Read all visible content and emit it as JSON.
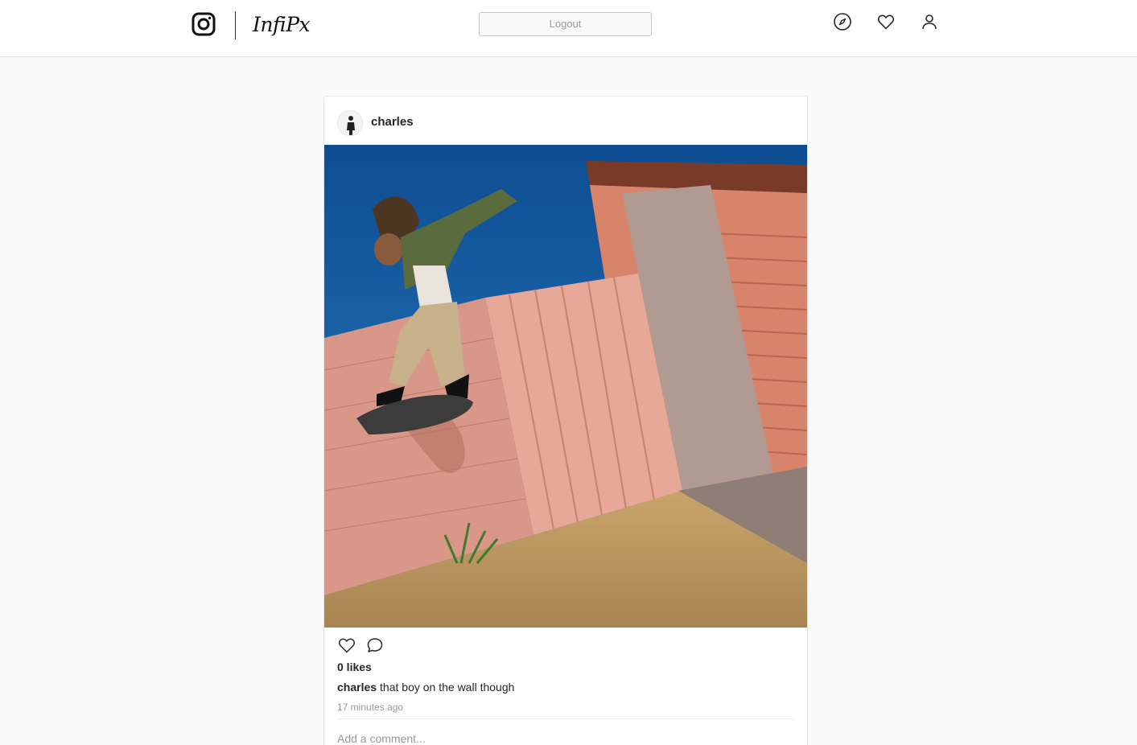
{
  "header": {
    "brand_name": "InfiPx",
    "logout_label": "Logout",
    "icons": [
      "camera-logo-icon",
      "compass-icon",
      "heart-icon",
      "profile-icon"
    ]
  },
  "post": {
    "username": "charles",
    "image_description_icon": "skateboarder-photo",
    "likes": "0 likes",
    "caption_user": "charles",
    "caption_text": "that boy on the wall though",
    "time_ago": "17 minutes ago",
    "comment_placeholder": "Add a comment..."
  },
  "colors": {
    "background": "#fafafa",
    "card": "#ffffff",
    "border": "#dbdbdb",
    "text": "#262626",
    "muted": "#999999"
  }
}
